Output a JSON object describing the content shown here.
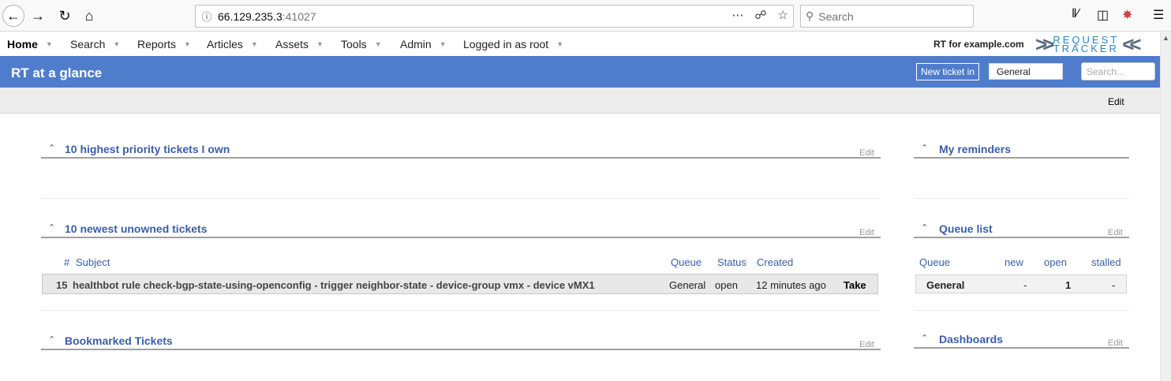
{
  "browser": {
    "url_host": "66.129.235.3",
    "url_port": ":41027",
    "search_placeholder": "Search"
  },
  "menu": {
    "items": [
      {
        "label": "Home"
      },
      {
        "label": "Search"
      },
      {
        "label": "Reports"
      },
      {
        "label": "Articles"
      },
      {
        "label": "Assets"
      },
      {
        "label": "Tools"
      },
      {
        "label": "Admin"
      },
      {
        "label": "Logged in as root"
      }
    ],
    "rt_for": "RT for example.com",
    "logo_line1": "REQUEST",
    "logo_line2": "TRACKER"
  },
  "header": {
    "title": "RT at a glance",
    "new_ticket_label": "New ticket in",
    "queue_selected": "General",
    "search_placeholder": "Search..."
  },
  "subbar": {
    "edit_label": "Edit"
  },
  "widgets": {
    "priority": {
      "title": "10 highest priority tickets I own",
      "edit": "Edit"
    },
    "unowned": {
      "title": "10 newest unowned tickets",
      "edit": "Edit",
      "columns": {
        "num": "#",
        "subject": "Subject",
        "queue": "Queue",
        "status": "Status",
        "created": "Created"
      },
      "rows": [
        {
          "id": "15",
          "subject": "healthbot rule check-bgp-state-using-openconfig - trigger neighbor-state - device-group vmx - device vMX1",
          "queue": "General",
          "status": "open",
          "created": "12 minutes ago",
          "action": "Take"
        }
      ]
    },
    "bookmarked": {
      "title": "Bookmarked Tickets",
      "edit": "Edit"
    },
    "reminders": {
      "title": "My reminders"
    },
    "queue_list": {
      "title": "Queue list",
      "edit": "Edit",
      "columns": {
        "queue": "Queue",
        "new": "new",
        "open": "open",
        "stalled": "stalled"
      },
      "rows": [
        {
          "queue": "General",
          "new": "-",
          "open": "1",
          "stalled": "-"
        }
      ]
    },
    "dashboards": {
      "title": "Dashboards",
      "edit": "Edit"
    }
  },
  "colors": {
    "title_bar": "#4f7dcb",
    "link_blue": "#3a5ea8"
  }
}
